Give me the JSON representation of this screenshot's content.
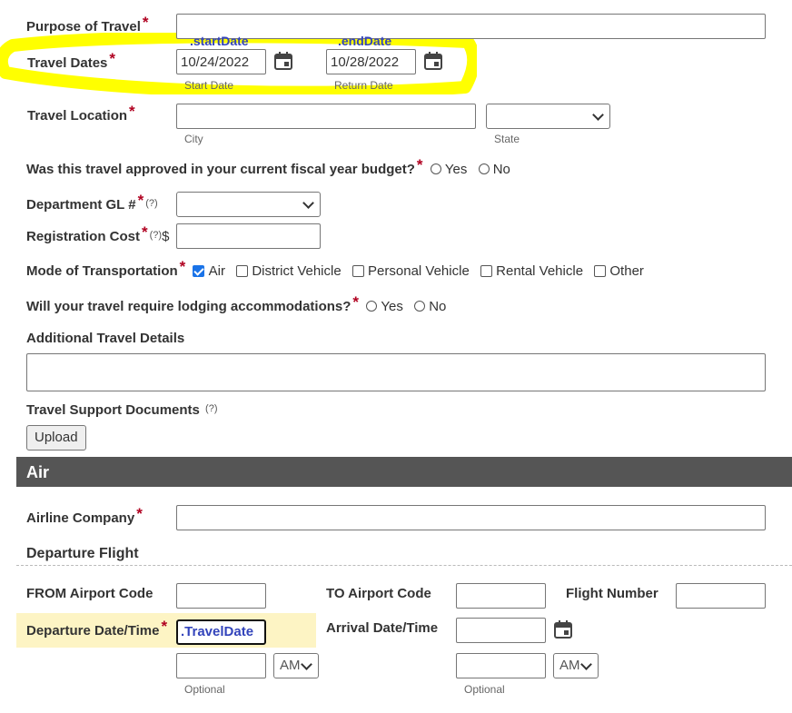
{
  "form": {
    "purpose": {
      "label": "Purpose of Travel",
      "value": ""
    },
    "dates": {
      "label": "Travel Dates",
      "start_tag": ".startDate",
      "end_tag": ".endDate",
      "start_value": "10/24/2022",
      "end_value": "10/28/2022",
      "start_sub": "Start Date",
      "end_sub": "Return Date",
      "highlight_color": "#ffff00"
    },
    "location": {
      "label": "Travel Location",
      "city_sub": "City",
      "state_sub": "State",
      "state_value": ""
    },
    "budget": {
      "label": "Was this travel approved in your current fiscal year budget?",
      "yes": "Yes",
      "no": "No"
    },
    "gl": {
      "label": "Department GL #",
      "hint": "(?)",
      "value": ""
    },
    "registration": {
      "label": "Registration Cost",
      "hint": "(?)",
      "currency": "$"
    },
    "transport": {
      "label": "Mode of Transportation",
      "options": [
        "Air",
        "District Vehicle",
        "Personal Vehicle",
        "Rental Vehicle",
        "Other"
      ],
      "checked": "Air"
    },
    "lodging": {
      "label": "Will your travel require lodging accommodations?",
      "yes": "Yes",
      "no": "No"
    },
    "details": {
      "label": "Additional Travel Details"
    },
    "documents": {
      "label": "Travel Support Documents",
      "hint": "(?)",
      "upload_label": "Upload"
    }
  },
  "air": {
    "section_title": "Air",
    "airline": {
      "label": "Airline Company"
    },
    "departure_heading": "Departure Flight",
    "from_label": "FROM Airport Code",
    "to_label": "TO Airport Code",
    "flight_label": "Flight Number",
    "departure_label": "Departure Date/Time",
    "departure_value": ".TravelDate",
    "arrival_label": "Arrival Date/Time",
    "ampm_value": "AM",
    "optional_sub": "Optional"
  },
  "colors": {
    "required": "#b00020",
    "section_bar": "#555555",
    "tag": "#3344bb",
    "focus_row": "#fdf4c4"
  }
}
